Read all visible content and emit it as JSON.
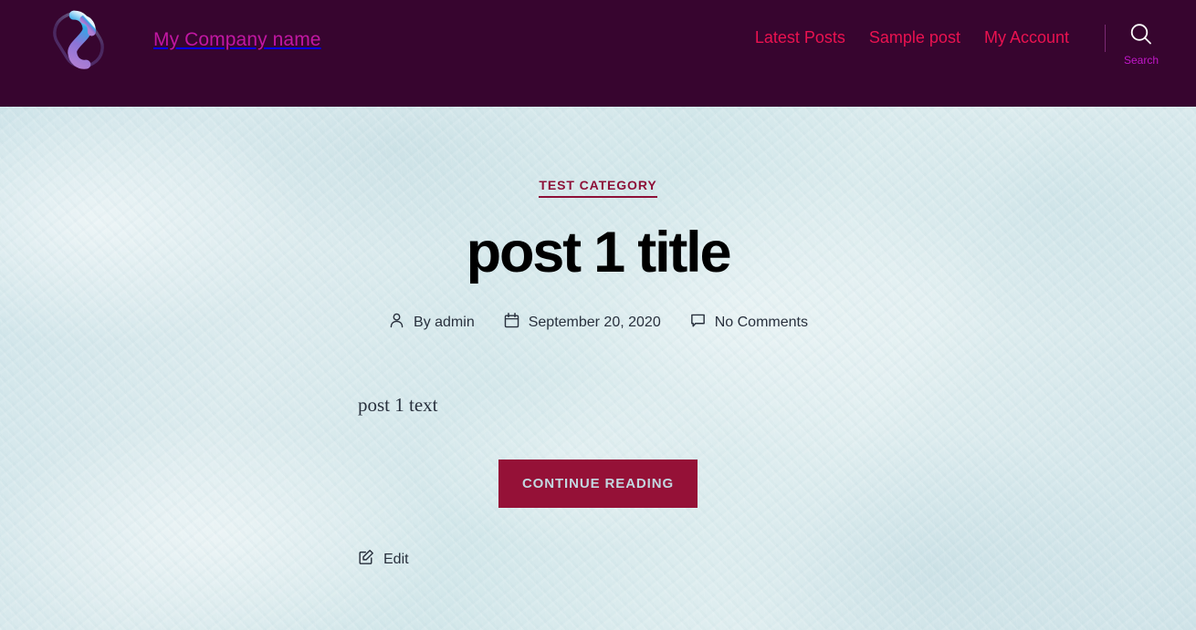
{
  "header": {
    "logo_icon": "company-logo-ribbon-icon",
    "brand_name": "My Company name",
    "nav": [
      {
        "label": "Latest Posts",
        "name": "nav-link-latest-posts"
      },
      {
        "label": "Sample post",
        "name": "nav-link-sample-post"
      },
      {
        "label": "My Account",
        "name": "nav-link-my-account"
      }
    ],
    "search": {
      "icon": "search-icon",
      "label": "Search"
    },
    "colors": {
      "background": "#37052f",
      "brand_text": "#c117a2",
      "nav_link": "#ea1250",
      "search_label": "#c117c9",
      "divider": "#7b2a73"
    }
  },
  "post": {
    "category": "TEST CATEGORY",
    "title": "post 1 title",
    "meta": {
      "author_icon": "person-icon",
      "author": "By admin",
      "date_icon": "calendar-icon",
      "date": "September 20, 2020",
      "comments_icon": "comment-bubble-icon",
      "comments": "No Comments"
    },
    "body_text": "post 1 text",
    "continue_label": "CONTINUE READING",
    "edit": {
      "icon": "edit-pencil-icon",
      "label": "Edit"
    },
    "colors": {
      "category": "#8d1038",
      "title": "#000000",
      "meta_text": "#28303d",
      "button_bg": "#951137",
      "button_text": "#c3d7e0",
      "page_background": "#d7e8eb"
    }
  }
}
